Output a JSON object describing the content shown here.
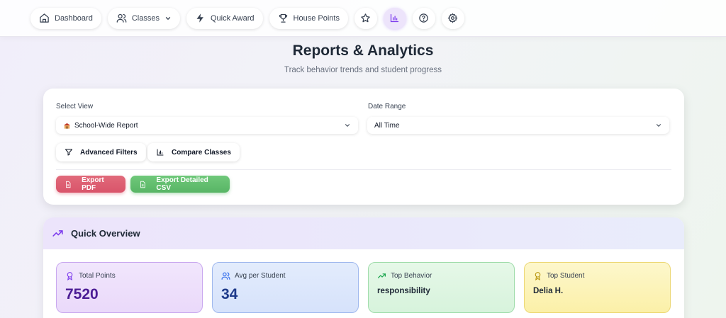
{
  "nav": {
    "dashboard": "Dashboard",
    "classes": "Classes",
    "quick_award": "Quick Award",
    "house_points": "House Points"
  },
  "header": {
    "title": "Reports & Analytics",
    "subtitle": "Track behavior trends and student progress"
  },
  "filters": {
    "view_label": "Select View",
    "view_value": "School-Wide Report",
    "date_label": "Date Range",
    "date_value": "All Time",
    "advanced_filters": "Advanced Filters",
    "compare_classes": "Compare Classes",
    "export_pdf": "Export PDF",
    "export_csv": "Export Detailed CSV"
  },
  "overview": {
    "title": "Quick Overview",
    "stats": [
      {
        "label": "Total Points",
        "value": "7520"
      },
      {
        "label": "Avg per Student",
        "value": "34"
      },
      {
        "label": "Top Behavior",
        "value": "responsibility"
      },
      {
        "label": "Top Student",
        "value": "Delia H."
      }
    ]
  },
  "colors": {
    "accent_purple": "#7c3aed",
    "export_pdf": "#d9546a",
    "export_csv": "#58b565"
  }
}
